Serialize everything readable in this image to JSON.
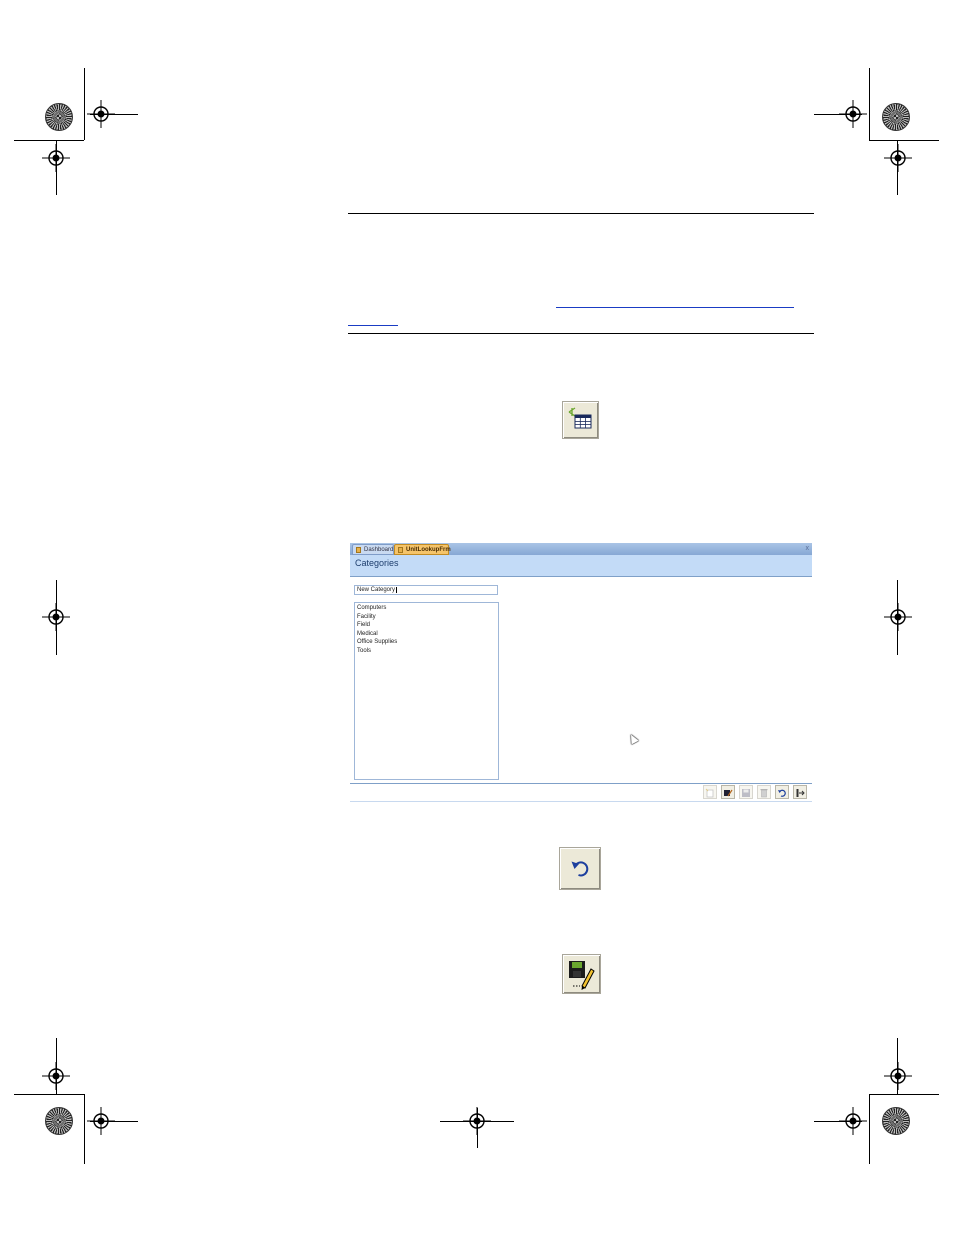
{
  "app": {
    "tabs": [
      {
        "label": "Dashboard"
      },
      {
        "label": "UnitLookupFrm"
      }
    ],
    "close_label": "x",
    "form_title": "Categories",
    "new_category_field": {
      "value": "New Category"
    },
    "categories": [
      "Computers",
      "Facility",
      "Field",
      "Medical",
      "Office Supplies",
      "Tools"
    ],
    "toolbar_icons": [
      "new-record-icon",
      "edit-record-icon",
      "save-record-icon",
      "delete-record-icon",
      "undo-icon",
      "exit-icon"
    ]
  },
  "icons": {
    "datasheet": "datasheet-form-icon",
    "undo": "undo-icon",
    "save_edit": "save-edit-icon"
  },
  "colors": {
    "tab_active": "#f5c46a",
    "header_band": "#c3dbf7",
    "link": "#1a3cc4"
  }
}
